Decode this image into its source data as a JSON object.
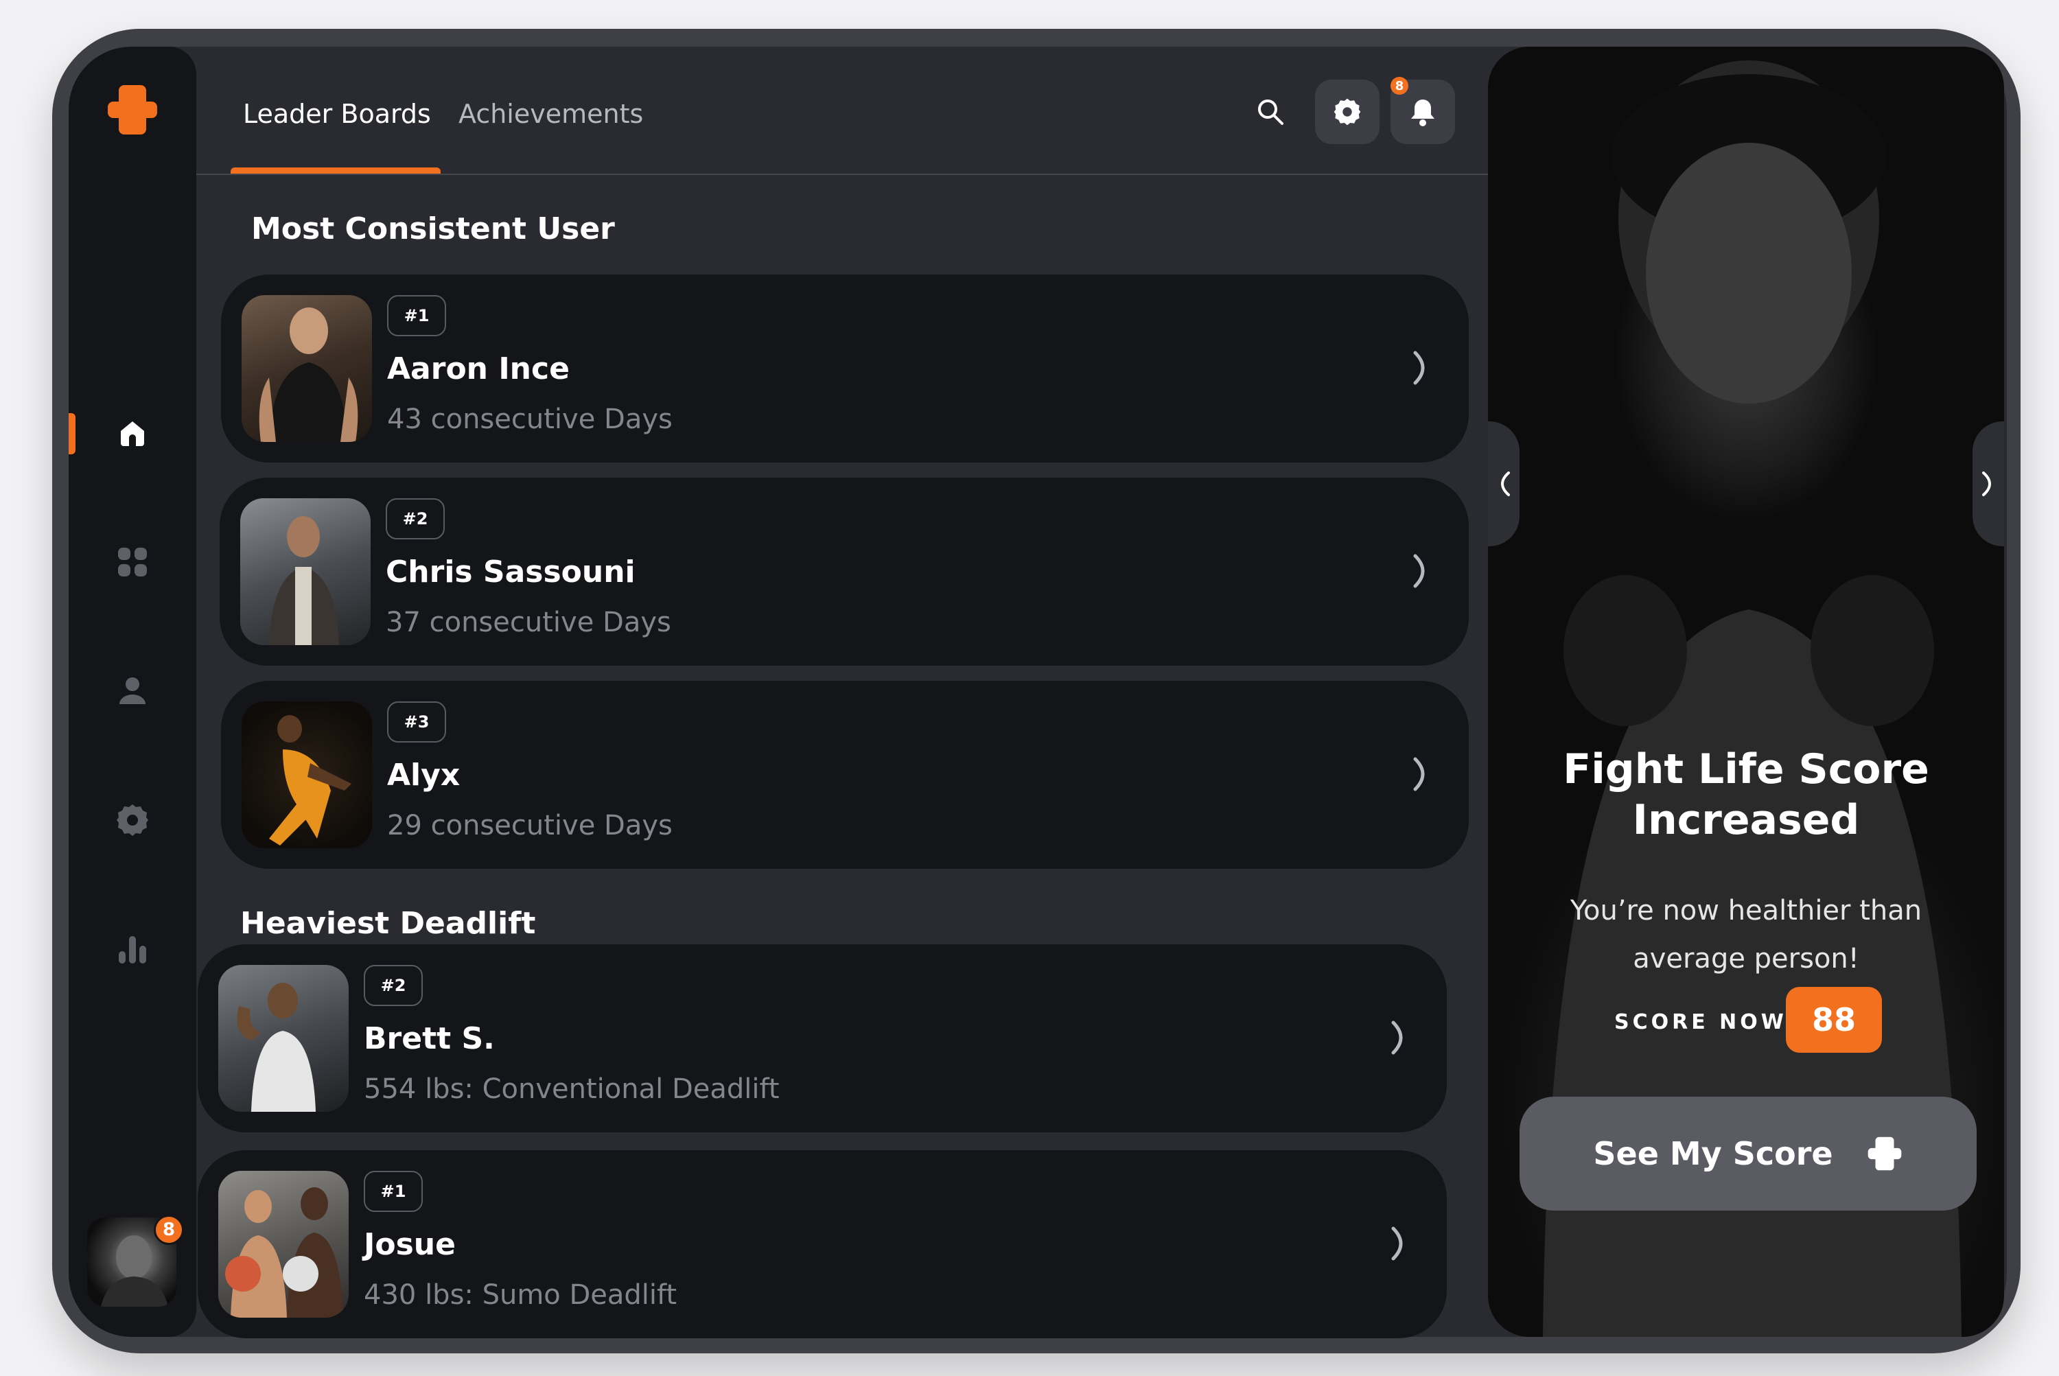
{
  "header": {
    "tabs": [
      {
        "label": "Leader Boards"
      },
      {
        "label": "Achievements"
      }
    ],
    "notification_count": "8"
  },
  "sidebar": {
    "items": [
      {
        "icon": "home-icon"
      },
      {
        "icon": "grid-icon"
      },
      {
        "icon": "user-icon"
      },
      {
        "icon": "settings-icon"
      },
      {
        "icon": "stats-icon"
      }
    ],
    "avatar_badge": "8"
  },
  "sections": [
    {
      "title": "Most Consistent User",
      "entries": [
        {
          "rank": "#1",
          "name": "Aaron Ince",
          "detail": "43 consecutive Days"
        },
        {
          "rank": "#2",
          "name": "Chris Sassouni",
          "detail": "37 consecutive Days"
        },
        {
          "rank": "#3",
          "name": "Alyx",
          "detail": "29 consecutive Days"
        }
      ]
    },
    {
      "title": "Heaviest Deadlift",
      "entries": [
        {
          "rank": "#2",
          "name": "Brett S.",
          "detail": "554 lbs: Conventional Deadlift"
        },
        {
          "rank": "#1",
          "name": "Josue",
          "detail": "430 lbs: Sumo Deadlift"
        }
      ]
    }
  ],
  "promo": {
    "title_line1": "Fight Life Score",
    "title_line2": "Increased",
    "subtitle_line1": "You’re now healthier than",
    "subtitle_line2": "average person!",
    "score_label": "SCORE NOW:",
    "score_value": "88",
    "cta_label": "See My Score"
  },
  "colors": {
    "accent": "#f3701f",
    "background": "#2a2b31",
    "card": "#141518",
    "secondary_text": "#85868d"
  }
}
